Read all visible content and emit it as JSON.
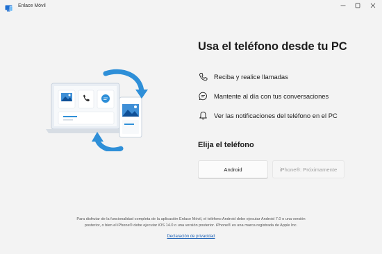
{
  "window": {
    "title": "Enlace Móvil"
  },
  "main": {
    "headline": "Usa el teléfono desde tu PC",
    "features": [
      {
        "icon": "phone-call-icon",
        "label": "Reciba y realice llamadas"
      },
      {
        "icon": "chat-bubble-icon",
        "label": "Mantente al día con tus conversaciones"
      },
      {
        "icon": "bell-icon",
        "label": "Ver las notificaciones del teléfono en el PC"
      }
    ],
    "choose_title": "Elija el teléfono",
    "android_label": "Android",
    "iphone_label": "iPhone®: Próximamente"
  },
  "footer": {
    "disclaimer_line1": "Para disfrutar de la funcionalidad completa de la aplicación Enlace Móvil, el teléfono Android debe ejecutar Android 7.0 o una versión",
    "disclaimer_line2": "posterior, o bien el iPhone® debe ejecutar iOS 14.0 o una versión posterior. iPhone® es una marca registrada de Apple Inc.",
    "privacy_link": "Declaración de privacidad"
  },
  "colors": {
    "accent": "#1a5fb4",
    "background": "#f3f3f3",
    "arrow_blue": "#2e8fd8"
  }
}
